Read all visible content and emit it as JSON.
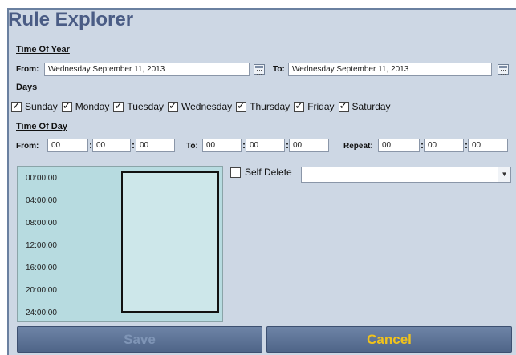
{
  "title": "Rule Explorer",
  "time_of_year": {
    "heading": "Time Of Year",
    "from_label": "From:",
    "from_value": "Wednesday September 11, 2013",
    "to_label": "To:",
    "to_value": "Wednesday September 11, 2013"
  },
  "days": {
    "heading": "Days",
    "items": [
      {
        "label": "Sunday",
        "checked": true
      },
      {
        "label": "Monday",
        "checked": true
      },
      {
        "label": "Tuesday",
        "checked": true
      },
      {
        "label": "Wednesday",
        "checked": true
      },
      {
        "label": "Thursday",
        "checked": true
      },
      {
        "label": "Friday",
        "checked": true
      },
      {
        "label": "Saturday",
        "checked": true
      }
    ]
  },
  "time_of_day": {
    "heading": "Time Of Day",
    "from_label": "From:",
    "from": [
      "00",
      "00",
      "00"
    ],
    "to_label": "To:",
    "to": [
      "00",
      "00",
      "00"
    ],
    "repeat_label": "Repeat:",
    "repeat": [
      "00",
      "00",
      "00"
    ],
    "separator": ":"
  },
  "timeline": {
    "ticks": [
      "00:00:00",
      "04:00:00",
      "08:00:00",
      "12:00:00",
      "16:00:00",
      "20:00:00",
      "24:00:00"
    ]
  },
  "self_delete": {
    "label": "Self Delete",
    "checked": false,
    "dropdown_value": ""
  },
  "buttons": {
    "save": "Save",
    "cancel": "Cancel"
  }
}
